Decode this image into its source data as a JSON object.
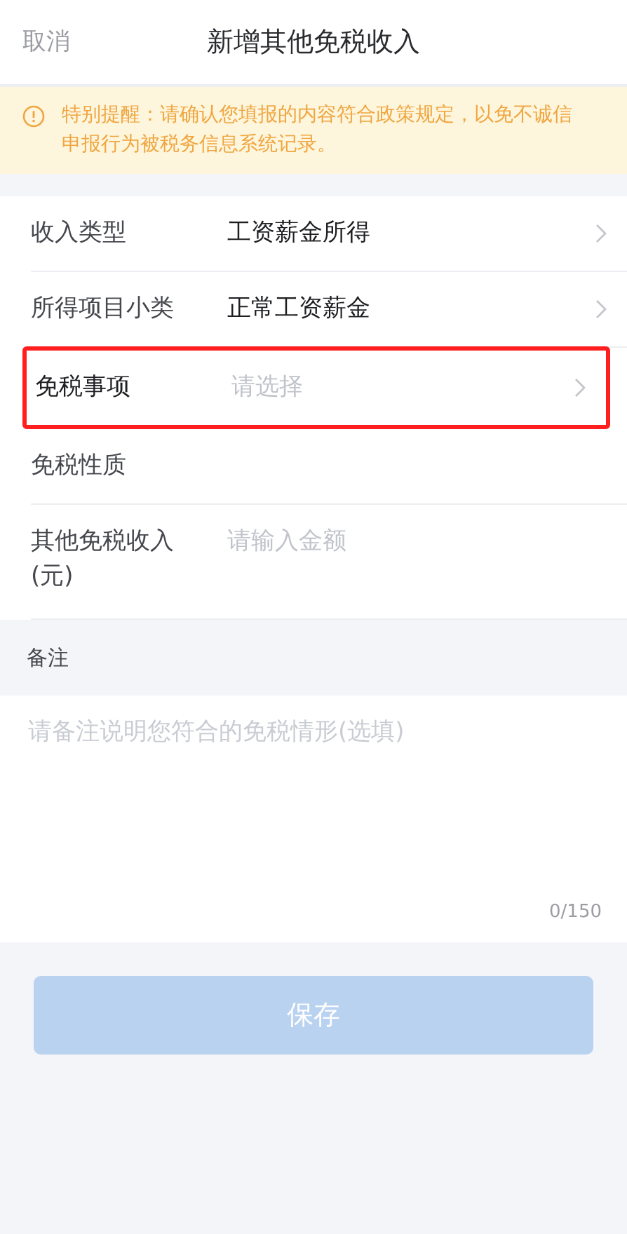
{
  "header": {
    "cancel": "取消",
    "title": "新增其他免税收入"
  },
  "notice": {
    "text": "特别提醒：请确认您填报的内容符合政策规定，以免不诚信申报行为被税务信息系统记录。"
  },
  "rows": [
    {
      "kind": "select",
      "label": "收入类型",
      "value": "工资薪金所得",
      "highlighted": false
    },
    {
      "kind": "select",
      "label": "所得项目小类",
      "value": "正常工资薪金",
      "highlighted": false
    },
    {
      "kind": "select",
      "label": "免税事项",
      "placeholder": "请选择",
      "highlighted": true
    },
    {
      "kind": "static",
      "label": "免税性质",
      "highlighted": false
    },
    {
      "kind": "input",
      "label": "其他免税收入(元)",
      "placeholder": "请输入金额",
      "highlighted": false
    }
  ],
  "remarks": {
    "title": "备注",
    "placeholder": "请备注说明您符合的免税情形(选填)",
    "counter": "0/150"
  },
  "save_button": {
    "label": "保存",
    "disabled": true
  }
}
